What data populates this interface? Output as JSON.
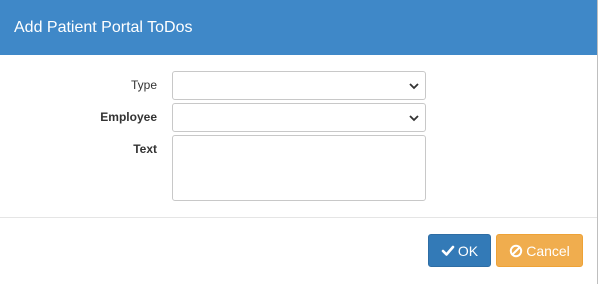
{
  "dialog": {
    "title": "Add Patient Portal ToDos",
    "header_color": "#3f88c8"
  },
  "form": {
    "type": {
      "label": "Type",
      "value": ""
    },
    "employee": {
      "label": "Employee",
      "value": ""
    },
    "text": {
      "label": "Text",
      "value": ""
    }
  },
  "footer": {
    "ok_label": "OK",
    "ok_icon": "check-icon",
    "ok_color": "#337ab7",
    "cancel_label": "Cancel",
    "cancel_icon": "ban-icon",
    "cancel_color": "#f0ad4e"
  }
}
